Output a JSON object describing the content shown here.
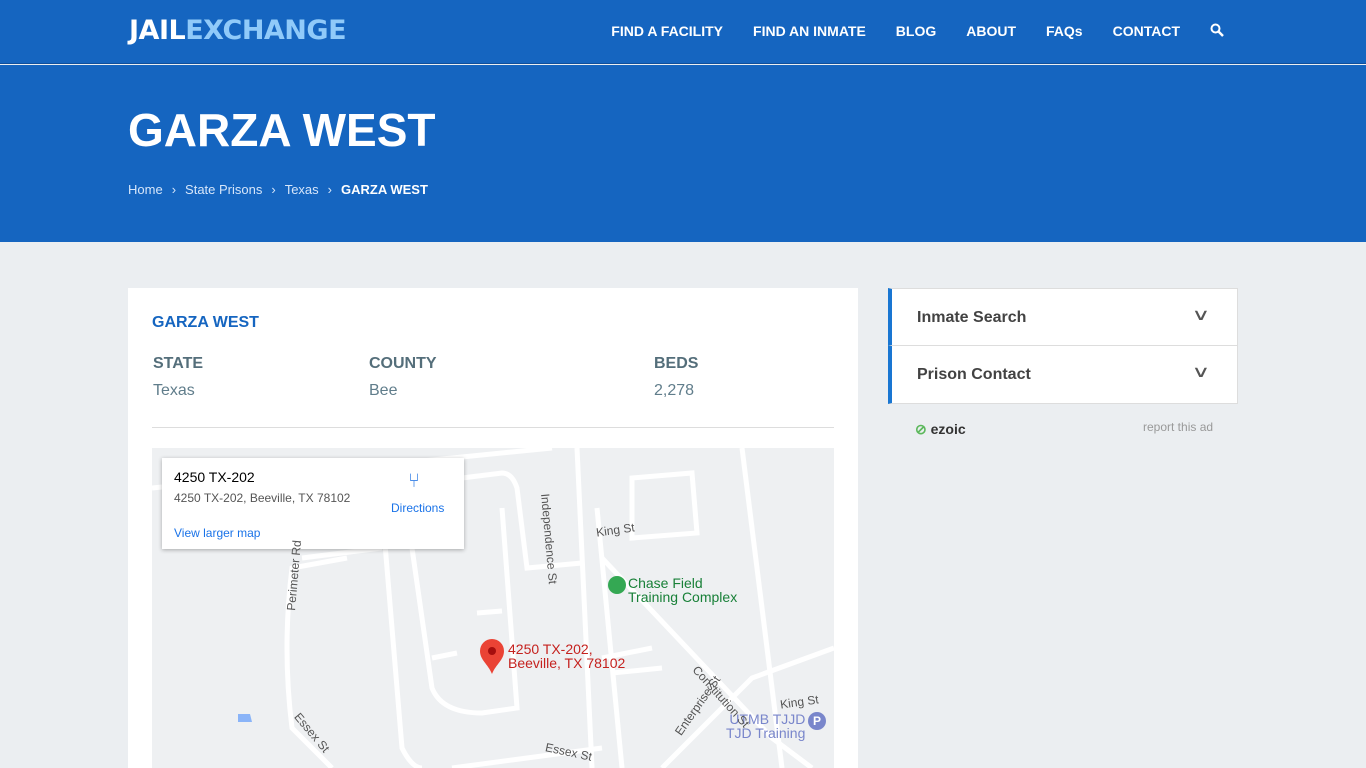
{
  "logo": {
    "part1": "JAIL",
    "part2": "EXCHANGE"
  },
  "nav": {
    "items": [
      "FIND A FACILITY",
      "FIND AN INMATE",
      "BLOG",
      "ABOUT",
      "FAQs",
      "CONTACT"
    ],
    "search_icon": "search-icon"
  },
  "hero": {
    "title": "GARZA WEST",
    "breadcrumb": [
      "Home",
      "State Prisons",
      "Texas",
      "GARZA WEST"
    ]
  },
  "facility": {
    "title": "GARZA WEST",
    "state_label": "STATE",
    "state": "Texas",
    "county_label": "COUNTY",
    "county": "Bee",
    "beds_label": "BEDS",
    "beds": "2,278"
  },
  "map": {
    "place": "4250 TX-202",
    "address": "4250 TX-202, Beeville, TX 78102",
    "directions": "Directions",
    "larger": "View larger map",
    "pin_line1": "4250 TX-202,",
    "pin_line2": "Beeville, TX 78102",
    "poi1_line1": "Chase Field",
    "poi1_line2": "Training Complex",
    "poi2_line1": "UTMB TJJD",
    "poi2_line2": "TJD Training",
    "streets": [
      "Independence St",
      "King St",
      "Perimeter Rd",
      "Constitution St",
      "Enterprise St",
      "King St",
      "Essex St",
      "Essex St"
    ]
  },
  "sidebar": {
    "items": [
      "Inmate Search",
      "Prison Contact"
    ],
    "ad_brand": "ezoic",
    "report": "report this ad"
  },
  "colors": {
    "brand": "#1565c0",
    "accent": "#90caf9"
  }
}
